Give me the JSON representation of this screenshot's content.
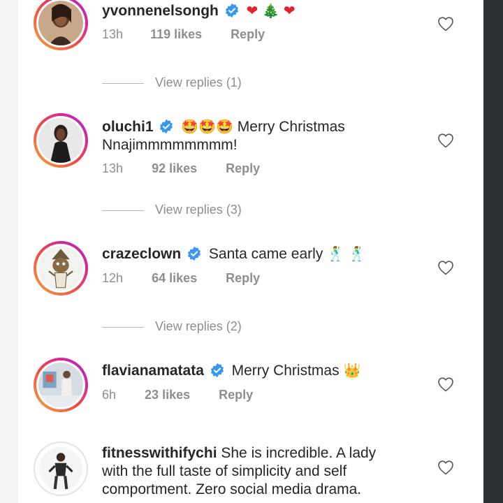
{
  "comments": [
    {
      "username": "yvonnenelsongh",
      "verified": true,
      "emojis": [
        "❤",
        "🎄",
        "❤"
      ],
      "text": "",
      "time": "13h",
      "likes": "119 likes",
      "reply": "Reply",
      "view_replies": "View replies (1)"
    },
    {
      "username": "oluchi1",
      "verified": true,
      "emojis": [
        "🤩",
        "🤩",
        "🤩"
      ],
      "text": "Merry Christmas Nnajimmmmmmmm!",
      "time": "13h",
      "likes": "92 likes",
      "reply": "Reply",
      "view_replies": "View replies (3)"
    },
    {
      "username": "crazeclown",
      "verified": true,
      "text": "Santa came early",
      "emojis": [
        "🕺",
        "🕺"
      ],
      "time": "12h",
      "likes": "64 likes",
      "reply": "Reply",
      "view_replies": "View replies (2)"
    },
    {
      "username": "flavianamatata",
      "verified": true,
      "text": "Merry Christmas",
      "emojis": [
        "👑"
      ],
      "time": "6h",
      "likes": "23 likes",
      "reply": "Reply"
    },
    {
      "username": "fitnesswithifychi",
      "verified": false,
      "text": "She is incredible. A lady with the full taste of simplicity and self comportment. Zero social media drama."
    }
  ],
  "colors": {
    "verified_badge": "#3897f0",
    "meta_text": "#8e8e8e",
    "story_ring_start": "#f9a73a",
    "story_ring_end": "#a82fc2"
  },
  "icons": {
    "like": "heart-outline-icon",
    "verified": "verified-badge-icon"
  }
}
